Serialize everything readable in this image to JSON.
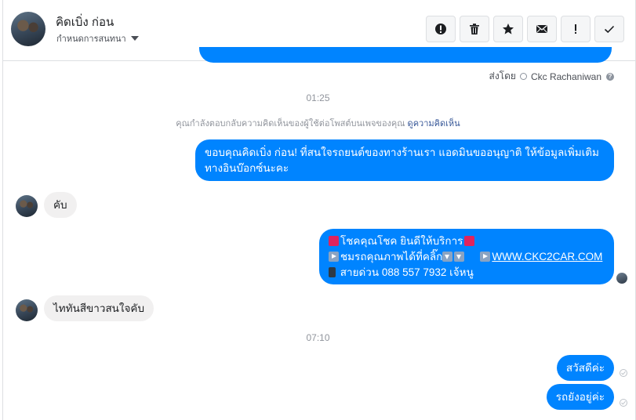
{
  "header": {
    "name": "คิดเบิ่ง ก่อน",
    "subtitle": "กำหนดการสนทนา",
    "buttons": [
      {
        "name": "alert-button",
        "icon": "exclamation-circle-icon"
      },
      {
        "name": "delete-button",
        "icon": "trash-icon"
      },
      {
        "name": "star-button",
        "icon": "star-icon"
      },
      {
        "name": "mail-button",
        "icon": "envelope-icon"
      },
      {
        "name": "important-button",
        "icon": "exclamation-icon"
      },
      {
        "name": "done-button",
        "icon": "check-icon"
      }
    ]
  },
  "conversation": {
    "sent_by_prefix": "ส่งโดย",
    "sent_by_name": "Ckc Rachaniwan",
    "time1": "01:25",
    "notice_text": "คุณกำลังตอบกลับความคิดเห็นของผู้ใช้ต่อโพสต์บนเพจของคุณ",
    "notice_link": "ดูความคิดเห็น",
    "msg_out_1_line1": "ขอบคุณคิดเบิ่ง ก่อน! ที่สนใจรถยนต์ของทางร้านเรา แอดมินขออนุญาติ ให้ข้อมูลเพิ่มเติม",
    "msg_out_1_line2": "ทางอินบ๊อกซ์นะคะ",
    "msg_in_1": "คับ",
    "msg_out_2_line1": "โชคคุณโชค ยินดีให้บริการ",
    "msg_out_2_line2": "ชมรถคุณภาพได้ที่คลิ๊ก",
    "msg_out_2_link": "WWW.CKC2CAR.COM",
    "msg_out_2_line3": "สายด่วน 088 557 7932 เจ้หนู",
    "msg_in_2": "ไททันสีขาวสนใจคับ",
    "time2": "07:10",
    "msg_out_3": "สวัสดีค่ะ",
    "msg_out_4": "รถยังอยู่ค่ะ"
  },
  "colors": {
    "outgoing_bubble": "#0084ff",
    "incoming_bubble": "#f1f0f0",
    "link": "#385898"
  }
}
